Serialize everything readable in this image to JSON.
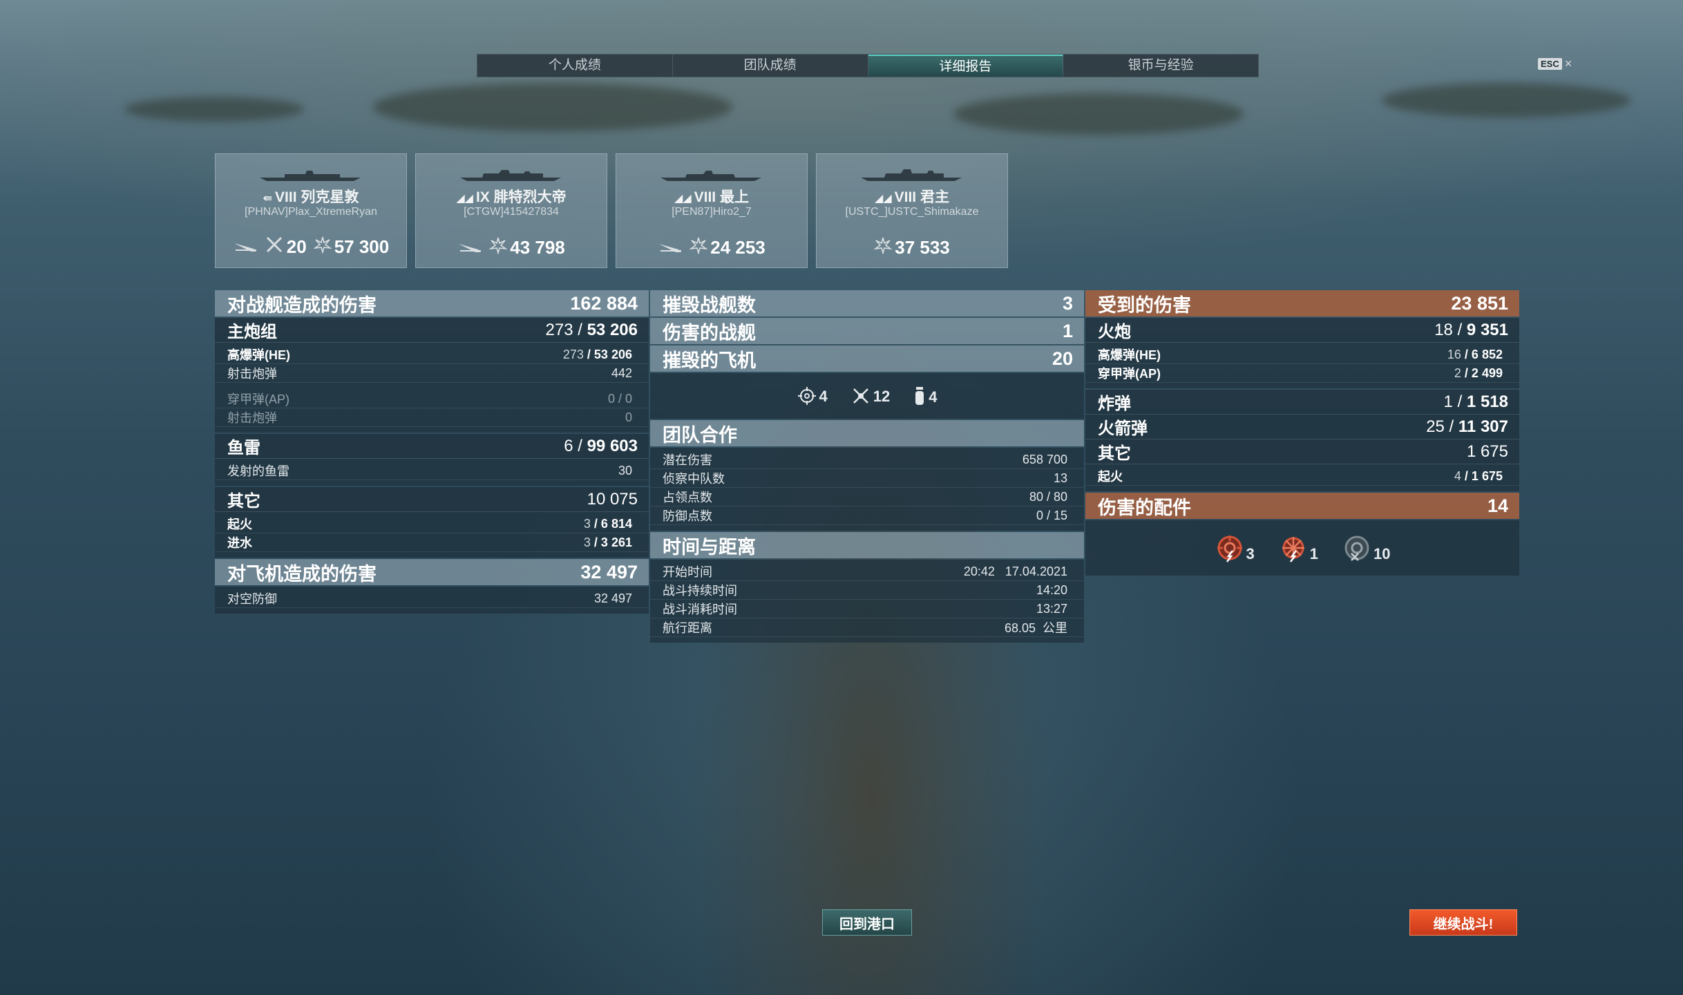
{
  "tabs": [
    {
      "label": "个人成绩",
      "active": false
    },
    {
      "label": "团队成绩",
      "active": false
    },
    {
      "label": "详细报告",
      "active": true
    },
    {
      "label": "银币与经验",
      "active": false
    }
  ],
  "esc": {
    "key": "ESC",
    "close": "×"
  },
  "ships": [
    {
      "tier": "VIII",
      "name": "列克星敦",
      "player": "[PHNAV]Plax_XtremeRyan",
      "class_icon": "carrier-icon",
      "planes_shot": "20",
      "damage": "57 300"
    },
    {
      "tier": "IX",
      "name": "腓特烈大帝",
      "player": "[CTGW]415427834",
      "class_icon": "battleship-icon",
      "damage": "43 798"
    },
    {
      "tier": "VIII",
      "name": "最上",
      "player": "[PEN87]Hiro2_7",
      "class_icon": "cruiser-icon",
      "damage": "24 253"
    },
    {
      "tier": "VIII",
      "name": "君主",
      "player": "[USTC_]USTC_Shimakaze",
      "class_icon": "battleship-icon",
      "damage": "37 533"
    }
  ],
  "left": {
    "ship_damage": {
      "label": "对战舰造成的伤害",
      "value": "162 884"
    },
    "main_battery": {
      "label": "主炮组",
      "hits": "273",
      "shots": "53",
      "dmg": "206"
    },
    "he": {
      "label": "高爆弹(HE)",
      "hits": "273",
      "shots": "53",
      "dmg": "206"
    },
    "he_fired": {
      "label": "射击炮弹",
      "value": "442"
    },
    "ap": {
      "label": "穿甲弹(AP)",
      "value": "0 / 0"
    },
    "ap_fired": {
      "label": "射击炮弹",
      "value": "0"
    },
    "torpedo": {
      "label": "鱼雷",
      "hits": "6",
      "shots": "99",
      "dmg": "603"
    },
    "torpedo_fired": {
      "label": "发射的鱼雷",
      "value": "30"
    },
    "other": {
      "label": "其它",
      "value": "10 075"
    },
    "fire": {
      "label": "起火",
      "hits": "3",
      "shots": "6",
      "dmg": "814"
    },
    "flood": {
      "label": "进水",
      "hits": "3",
      "shots": "3",
      "dmg": "261"
    },
    "plane_damage": {
      "label": "对飞机造成的伤害",
      "value": "32 497"
    },
    "aa": {
      "label": "对空防御",
      "value": "32 497"
    }
  },
  "middle": {
    "ships_destroyed": {
      "label": "摧毁战舰数",
      "value": "3"
    },
    "ships_damaged": {
      "label": "伤害的战舰",
      "value": "1"
    },
    "planes_destroyed": {
      "label": "摧毁的飞机",
      "value": "20"
    },
    "plane_breakdown": [
      {
        "icon": "crosshair-icon",
        "value": "4"
      },
      {
        "icon": "fighter-plane-icon",
        "value": "12"
      },
      {
        "icon": "bomb-icon",
        "value": "4"
      }
    ],
    "team": {
      "label": "团队合作"
    },
    "potential": {
      "label": "潜在伤害",
      "value": "658 700"
    },
    "spotted": {
      "label": "侦察中队数",
      "value": "13"
    },
    "capture": {
      "label": "占领点数",
      "value": "80 / 80"
    },
    "defend": {
      "label": "防御点数",
      "value": "0 / 15"
    },
    "time": {
      "label": "时间与距离"
    },
    "start": {
      "label": "开始时间",
      "time": "20:42",
      "date": "17.04.2021"
    },
    "duration": {
      "label": "战斗持续时间",
      "value": "14:20"
    },
    "elapsed": {
      "label": "战斗消耗时间",
      "value": "13:27"
    },
    "distance": {
      "label": "航行距离",
      "value": "68.05",
      "unit": "公里"
    }
  },
  "right": {
    "received": {
      "label": "受到的伤害",
      "value": "23 851"
    },
    "guns": {
      "label": "火炮",
      "hits": "18",
      "shots": "9",
      "dmg": "351"
    },
    "he": {
      "label": "高爆弹(HE)",
      "hits": "16",
      "shots": "6",
      "dmg": "852"
    },
    "ap": {
      "label": "穿甲弹(AP)",
      "hits": "2",
      "shots": "2",
      "dmg": "499"
    },
    "bombs": {
      "label": "炸弹",
      "hits": "1",
      "shots": "1",
      "dmg": "518"
    },
    "rockets": {
      "label": "火箭弹",
      "hits": "25",
      "shots": "11",
      "dmg": "307"
    },
    "other": {
      "label": "其它",
      "value": "1 675"
    },
    "fire": {
      "label": "起火",
      "hits": "4",
      "shots": "1",
      "dmg": "675"
    },
    "modules": {
      "label": "伤害的配件",
      "value": "14"
    },
    "module_icons": [
      {
        "icon": "damaged-module-icon",
        "value": "3"
      },
      {
        "icon": "damaged-steering-icon",
        "value": "1"
      },
      {
        "icon": "destroyed-module-icon",
        "value": "10"
      }
    ]
  },
  "buttons": {
    "port": "回到港口",
    "continue": "继续战斗!"
  },
  "colors": {
    "accent_orange": "#a86240",
    "tab_active": "#3a6b6a",
    "continue": "#e04a22"
  }
}
